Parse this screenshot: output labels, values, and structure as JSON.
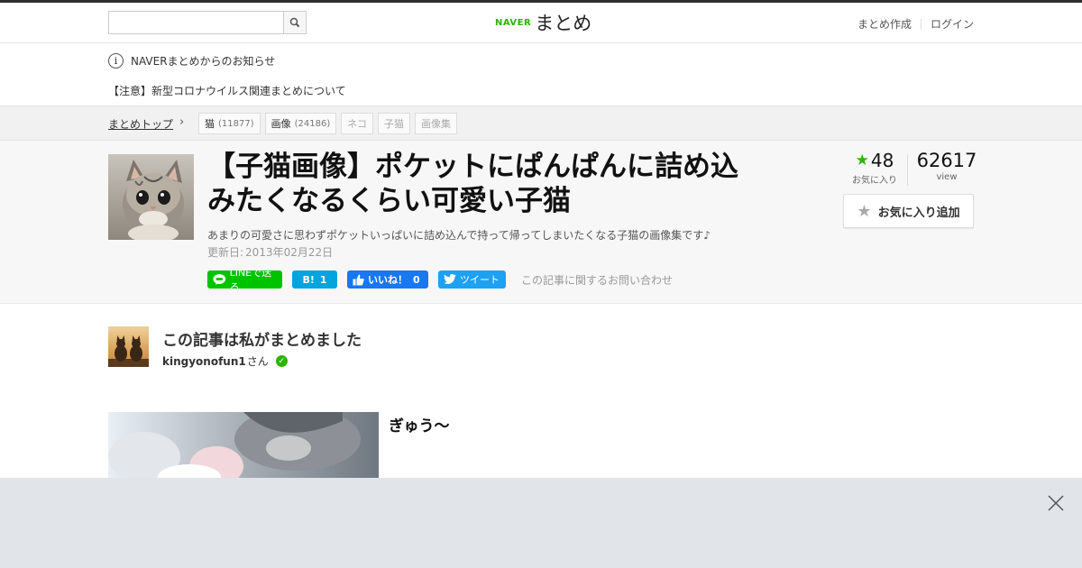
{
  "header": {
    "search_placeholder": "",
    "logo_brand": "NAVER",
    "logo_title": "まとめ",
    "nav": [
      "まとめ作成",
      "ログイン"
    ]
  },
  "notice": {
    "label": "NAVERまとめからのお知らせ",
    "message": "【注意】新型コロナウイルス関連まとめについて"
  },
  "breadcrumb": {
    "top": "まとめトップ",
    "tags": [
      {
        "label": "猫",
        "count": "(11877)"
      },
      {
        "label": "画像",
        "count": "(24186)"
      },
      {
        "label": "ネコ",
        "count": ""
      },
      {
        "label": "子猫",
        "count": ""
      },
      {
        "label": "画像集",
        "count": ""
      }
    ]
  },
  "article": {
    "title": "【子猫画像】ポケットにぱんぱんに詰め込みたくなるくらい可愛い子猫",
    "description": "あまりの可愛さに思わずポケットいっぱいに詰め込んで持って帰ってしまいたくなる子猫の画像集です♪",
    "updated_label": "更新日:",
    "updated_date": "2013年02月22日",
    "favorites": "48",
    "favorites_label": "お気に入り",
    "views": "62617",
    "views_label": "view",
    "fav_button": "お気に入り追加"
  },
  "social": {
    "line": "LINEで送る",
    "hatena_label": "B!",
    "hatena_count": "1",
    "fb_label": "いいね！",
    "fb_count": "0",
    "tweet": "ツイート",
    "inquiry": "この記事に関するお問い合わせ"
  },
  "author": {
    "lead": "この記事は私がまとめました",
    "name": "kingyonofun1",
    "suffix": "さん"
  },
  "item": {
    "caption": "ぎゅう〜"
  },
  "colors": {
    "brand_green": "#2db400",
    "line_green": "#00c300",
    "hatena_blue": "#00a4de",
    "facebook_blue": "#1877f2",
    "twitter_blue": "#1da1f2"
  }
}
